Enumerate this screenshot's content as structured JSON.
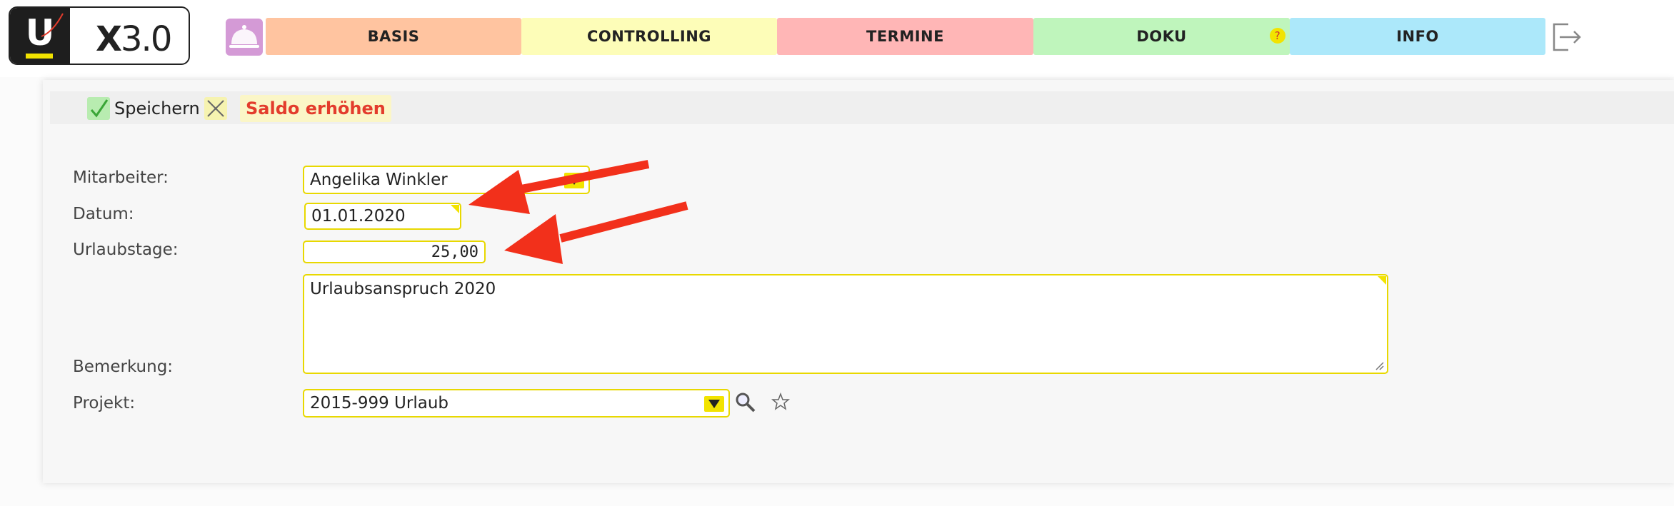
{
  "header": {
    "logo_letter": "U",
    "logo_text_x": "X",
    "logo_text_version": "3.0",
    "nav": [
      {
        "label": "BASIS",
        "color": "#ffc4a0"
      },
      {
        "label": "CONTROLLING",
        "color": "#fdfdb8"
      },
      {
        "label": "TERMINE",
        "color": "#ffb6b6"
      },
      {
        "label": "DOKU",
        "color": "#bff5bc",
        "help": "?"
      },
      {
        "label": "INFO",
        "color": "#ace8fa"
      }
    ]
  },
  "toolbar": {
    "save_label": "Speichern",
    "saldo_label": "Saldo erhöhen"
  },
  "form": {
    "mitarbeiter": {
      "label": "Mitarbeiter:",
      "value": "Angelika Winkler"
    },
    "datum": {
      "label": "Datum:",
      "value": "01.01.2020"
    },
    "urlaubstage": {
      "label": "Urlaubstage:",
      "value": "25,00"
    },
    "bemerkung": {
      "label": "Bemerkung:",
      "value": "Urlaubsanspruch 2020"
    },
    "projekt": {
      "label": "Projekt:",
      "value": "2015-999 Urlaub"
    }
  },
  "colors": {
    "field_border": "#e8d800",
    "annotation_arrow": "#f2301b",
    "saldo_text": "#e33c2c"
  }
}
